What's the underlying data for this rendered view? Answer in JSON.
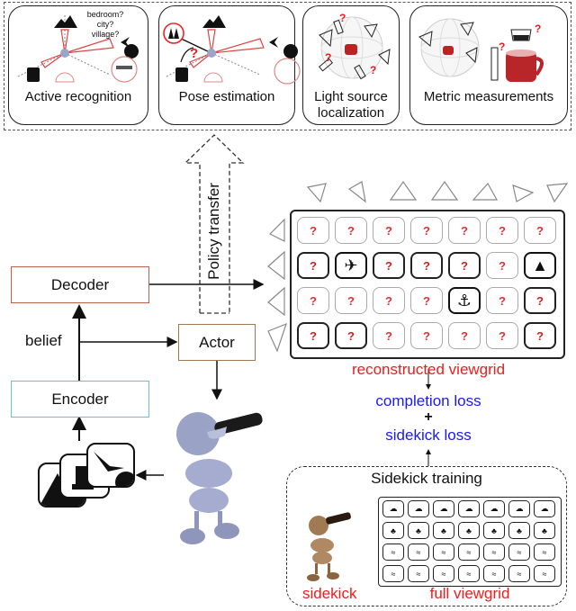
{
  "tasks": {
    "active_recognition": {
      "label": "Active recognition",
      "questions": [
        "bedroom?",
        "city?",
        "village?"
      ]
    },
    "pose_estimation": {
      "label": "Pose estimation",
      "question_mark": "?"
    },
    "light_source": {
      "label_line1": "Light source",
      "label_line2": "localization",
      "question_mark": "?"
    },
    "metric": {
      "label": "Metric measurements",
      "question_mark": "?"
    }
  },
  "policy_transfer": {
    "label": "Policy transfer"
  },
  "modules": {
    "decoder": "Decoder",
    "encoder": "Encoder",
    "actor": "Actor",
    "belief": "belief"
  },
  "viewgrid": {
    "label": "reconstructed viewgrid",
    "rows": [
      [
        "faded",
        "faded",
        "faded",
        "faded",
        "faded",
        "faded",
        "faded"
      ],
      [
        "?",
        "bird",
        "?",
        "?",
        "?",
        "faded",
        "mountain"
      ],
      [
        "faded",
        "faded",
        "faded",
        "faded",
        "ship",
        "faded",
        "?"
      ],
      [
        "?",
        "?",
        "faded",
        "faded",
        "faded",
        "faded",
        "?"
      ]
    ],
    "question_mark": "?"
  },
  "losses": {
    "completion": "completion loss",
    "plus": "+",
    "sidekick": "sidekick loss"
  },
  "sidekick_training": {
    "title": "Sidekick training",
    "sidekick_label": "sidekick",
    "full_viewgrid_label": "full viewgrid"
  },
  "colors": {
    "red": "#ee1c1c",
    "blue": "#1a1aee",
    "decoder_border": "#c0604a",
    "encoder_border": "#6cc2c2",
    "actor_border": "#a07850"
  }
}
